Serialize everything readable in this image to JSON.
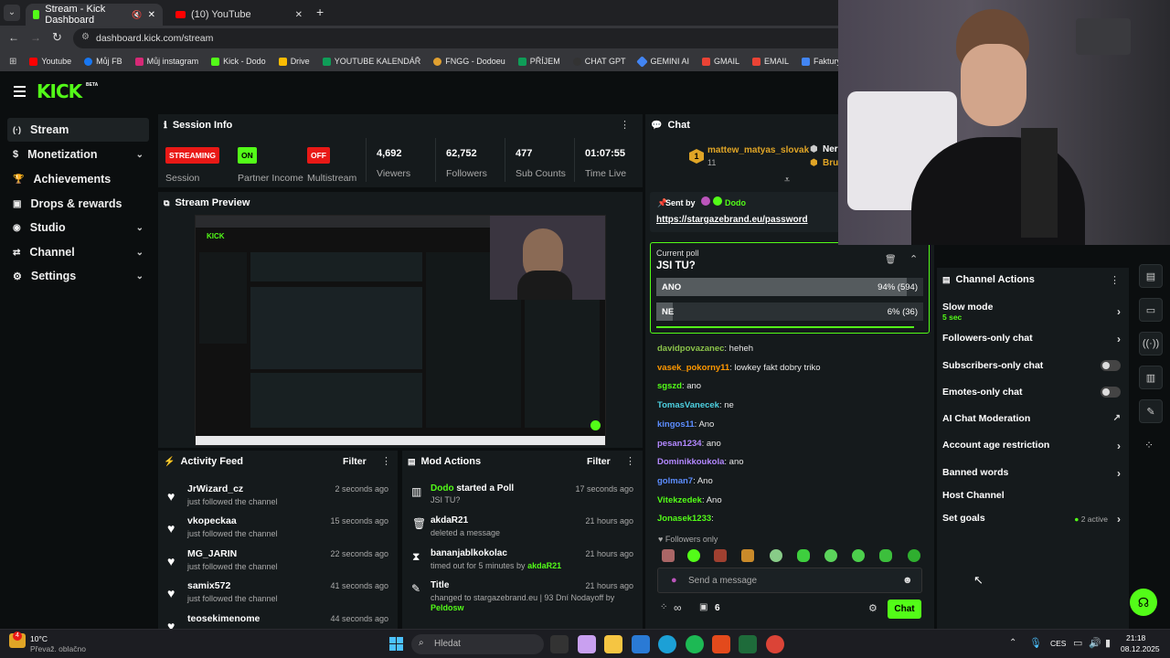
{
  "browser": {
    "tabs": [
      {
        "title": "Stream - Kick Dashboard"
      },
      {
        "title": "(10) YouTube"
      }
    ],
    "url": "dashboard.kick.com/stream",
    "bookmarks": [
      "Youtube",
      "Můj FB",
      "Můj instagram",
      "Kick - Dodo",
      "Drive",
      "YOUTUBE KALENDÁŘ",
      "FNGG - Dodoeu",
      "PŘÍJEM",
      "CHAT GPT",
      "GEMINI AI",
      "GMAIL",
      "EMAIL",
      "Faktury - Vytváření",
      "F"
    ]
  },
  "site": {
    "logo": "KICK",
    "logo_sup": "BETA"
  },
  "sidebar": {
    "items": [
      {
        "label": "Stream",
        "icon": "stream-icon",
        "chev": ""
      },
      {
        "label": "Monetization",
        "icon": "dollar-icon",
        "chev": "⌄"
      },
      {
        "label": "Achievements",
        "icon": "trophy-icon",
        "chev": ""
      },
      {
        "label": "Drops & rewards",
        "icon": "gift-icon",
        "chev": ""
      },
      {
        "label": "Studio",
        "icon": "studio-icon",
        "chev": "⌄"
      },
      {
        "label": "Channel",
        "icon": "channel-icon",
        "chev": "⌄"
      },
      {
        "label": "Settings",
        "icon": "gear-icon",
        "chev": "⌄"
      }
    ]
  },
  "session": {
    "title": "Session Info",
    "stats": [
      {
        "value": "STREAMING",
        "label": "Session"
      },
      {
        "value": "ON",
        "label": "Partner Income"
      },
      {
        "value": "OFF",
        "label": "Multistream"
      },
      {
        "value": "4,692",
        "label": "Viewers"
      },
      {
        "value": "62,752",
        "label": "Followers"
      },
      {
        "value": "477",
        "label": "Sub Counts"
      },
      {
        "value": "01:07:55",
        "label": "Time Live"
      }
    ]
  },
  "preview": {
    "title": "Stream Preview"
  },
  "activity": {
    "title": "Activity Feed",
    "filter": "Filter",
    "rows": [
      {
        "name": "JrWizard_cz",
        "sub": "just followed the channel",
        "time": "2 seconds ago"
      },
      {
        "name": "vkopeckaa",
        "sub": "just followed the channel",
        "time": "15 seconds ago"
      },
      {
        "name": "MG_JARIN",
        "sub": "just followed the channel",
        "time": "22 seconds ago"
      },
      {
        "name": "samix572",
        "sub": "just followed the channel",
        "time": "41 seconds ago"
      },
      {
        "name": "teosekimenome",
        "sub": "",
        "time": "44 seconds ago"
      }
    ]
  },
  "mod": {
    "title": "Mod Actions",
    "filter": "Filter",
    "rows": [
      {
        "title_a": "Dodo",
        "title_b": " started a Poll",
        "sub": "JSI TU?",
        "time": "17 seconds ago"
      },
      {
        "title_a": "akdaR21",
        "title_b": "",
        "sub": "deleted a message",
        "time": "21 hours ago"
      },
      {
        "title_a": "bananjablkokolac",
        "title_b": "",
        "sub": "timed out for 5 minutes by ",
        "sub2": "akdaR21",
        "time": "21 hours ago"
      },
      {
        "title_a": "Title",
        "title_b": "",
        "sub": "changed to stargazebrand.eu | 93 Dní Nodayoff by",
        "sub2": "Peldosw",
        "time": "21 hours ago"
      }
    ]
  },
  "chat": {
    "title": "Chat",
    "top_user": "mattew_matyas_slovak",
    "top_user_count": "11",
    "top_rank": "1",
    "side_names": [
      "Ner",
      "Bru"
    ],
    "pinned_sent_by": "Sent by",
    "pinned_user": "Dodo",
    "pinned_link": "https://stargazebrand.eu/password",
    "poll": {
      "label": "Current poll",
      "question": "JSI TU?",
      "options": [
        {
          "label": "ANO",
          "result": "94% (594)",
          "percent": 94
        },
        {
          "label": "NE",
          "result": "6% (36)",
          "percent": 6
        }
      ]
    },
    "messages": [
      {
        "user": "davidpovazanec",
        "color": "#8bc34a",
        "text": "heheh"
      },
      {
        "user": "vasek_pokorny11",
        "color": "#ff9800",
        "text": "lowkey fakt dobry triko"
      },
      {
        "user": "sgszd",
        "color": "#53fc18",
        "text": "ano"
      },
      {
        "user": "TomasVanecek",
        "color": "#4dd0e1",
        "text": "ne"
      },
      {
        "user": "kingos11",
        "color": "#5c8dff",
        "text": "Ano"
      },
      {
        "user": "pesan1234",
        "color": "#b388ff",
        "text": "ano"
      },
      {
        "user": "Dominikkoukola",
        "color": "#b388ff",
        "text": "ano"
      },
      {
        "user": "golman7",
        "color": "#5c8dff",
        "text": "Ano"
      },
      {
        "user": "Vitekzedek",
        "color": "#53fc18",
        "text": "Ano"
      },
      {
        "user": "Jonasek1233",
        "color": "#53fc18",
        "text": ""
      }
    ],
    "followers_only": "Followers only",
    "send_placeholder": "Send a message",
    "footer_count": "6",
    "footer_inf": "∞",
    "send_button": "Chat"
  },
  "channel_actions": {
    "title": "Channel Actions",
    "rows": [
      {
        "label": "Slow mode",
        "sub": "5 sec",
        "control": "›"
      },
      {
        "label": "Followers-only chat",
        "control": "›"
      },
      {
        "label": "Subscribers-only chat",
        "control": "toggle"
      },
      {
        "label": "Emotes-only chat",
        "control": "toggle"
      },
      {
        "label": "AI Chat Moderation",
        "control": "↗"
      },
      {
        "label": "Account age restriction",
        "control": "›"
      },
      {
        "label": "Banned words",
        "control": "›"
      },
      {
        "label": "Host Channel",
        "control": ""
      },
      {
        "label": "Set goals",
        "control": "›",
        "status": "2 active"
      }
    ]
  },
  "taskbar": {
    "temp": "10°C",
    "weather": "Převaž. oblačno",
    "search": "Hledat",
    "lang": "CES",
    "time": "21:18",
    "date": "08.12.2025",
    "notif": "4"
  },
  "colors": {
    "accent": "#53fc18",
    "bg": "#0b0e0f",
    "panel": "#151a1c",
    "red": "#e91916"
  }
}
